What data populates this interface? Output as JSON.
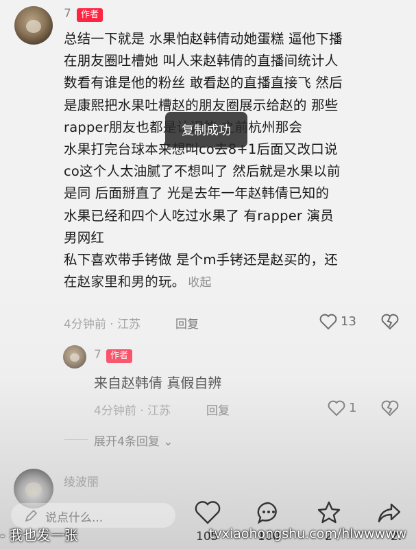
{
  "main_comment": {
    "username": "7",
    "badge": "作者",
    "lines": [
      "总结一下就是 水果怕赵韩倩动她蛋糕 逼他下播",
      "在朋友圈吐槽她 叫人来赵韩倩的直播间统计人",
      "数看有谁是他的粉丝 敢看赵的直播直接飞 然后",
      "是康熙把水果吐槽赵的朋友圈展示给赵的 那些",
      "rapper朋友也都是认识的 之前杭州那会",
      "水果打完台球本来想叫co去8+1后面又改口说",
      "co这个人太油腻了不想叫了 然后就是水果以前",
      "是同 后面掰直了 光是去年一年赵韩倩已知的",
      "水果已经和四个人吃过水果了 有rapper 演员",
      "男网红",
      "私下喜欢带手铐做 是个m手铐还是赵买的，还",
      "在赵家里和男的玩。"
    ],
    "collapse_label": "收起",
    "time_location": "4分钟前 · 江苏",
    "reply_label": "回复",
    "like_count": "13"
  },
  "toast": "复制成功",
  "reply_comment": {
    "username": "7",
    "badge": "作者",
    "text": "来自赵韩倩 真假自辨",
    "time_location": "4分钟前 · 江苏",
    "reply_label": "回复",
    "like_count": "1"
  },
  "expand_replies": "展开4条回复",
  "next_comment": {
    "username": "绫波丽"
  },
  "input_placeholder": "说点什么...",
  "overlay_caption": "- 我也发一张",
  "bottom_bar": {
    "like_count": "105",
    "comment_count": "100",
    "star_count": "2",
    "share_count": "2."
  },
  "watermark": "tvxiaohongshu.com/hlwwwww",
  "colors": {
    "badge": "#ff2442",
    "text": "#1a1a1a",
    "meta": "#999999"
  }
}
